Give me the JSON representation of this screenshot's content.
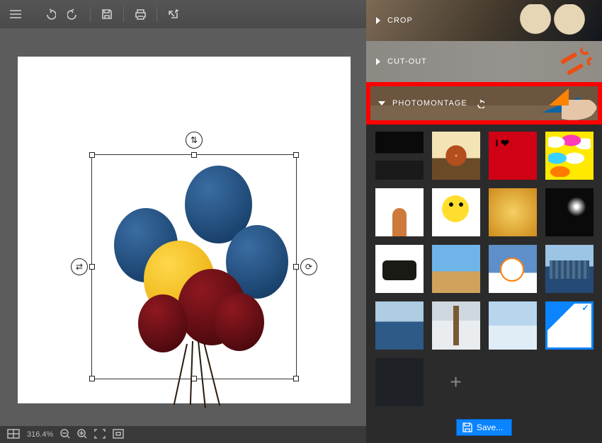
{
  "toolbar": {
    "menu": "menu",
    "undo": "undo",
    "redo": "redo",
    "save": "save",
    "print": "print",
    "share": "share"
  },
  "sections": {
    "crop": "CROP",
    "cutout": "CUT-OUT",
    "photomontage": "PHOTOMONTAGE"
  },
  "canvas": {
    "image_description": "balloons cluster (blue, yellow, dark red)",
    "selection_tools": {
      "swap": "swap",
      "flip_h": "flip horizontal",
      "rotate": "rotate"
    }
  },
  "status": {
    "zoom": "316.4%"
  },
  "templates": [
    "moon-landscape",
    "heart-tree-sunset",
    "red-love",
    "comic-bubbles",
    "puppy-white",
    "cartoon-monster",
    "gold-bokeh",
    "camera-flash",
    "cow-closeup",
    "paris-dock",
    "snowman",
    "city-skyline",
    "venice-boats",
    "winter-trees",
    "snowy-road",
    "blank-white",
    "dark-solid",
    "add-new"
  ],
  "selected_template_index": 15,
  "save_button": "Save..."
}
